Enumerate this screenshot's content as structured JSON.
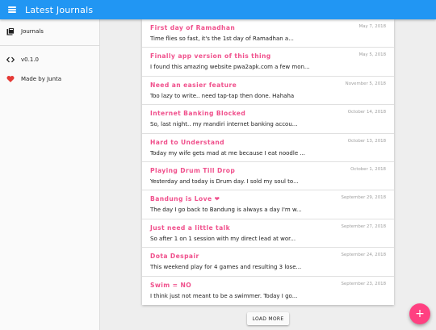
{
  "appbar": {
    "title": "Latest Journals",
    "color": "#2196f3"
  },
  "sidebar": {
    "items": [
      {
        "label": "Journals",
        "icon": "book-stack-icon"
      },
      {
        "label": "v0.1.0",
        "icon": "code-icon"
      },
      {
        "label": "Made by Junta",
        "icon": "heart-icon"
      }
    ]
  },
  "entries": [
    {
      "title": "First day of Ramadhan",
      "snippet": "Time flies so fast, it's the 1st day of Ramadhan a...",
      "date": "May 7, 2018"
    },
    {
      "title": "Finally app version of this thing",
      "snippet": "I found this amazing website pwa2apk.com a few mon...",
      "date": "May 5, 2018"
    },
    {
      "title": "Need an easier feature",
      "snippet": "Too lazy to write.. need tap-tap then done. Hahaha",
      "date": "November 5, 2018"
    },
    {
      "title": "Internet Banking Blocked",
      "snippet": "So, last night.. my mandiri internet banking accou...",
      "date": "October 14, 2018"
    },
    {
      "title": "Hard to Understand",
      "snippet": "Today my wife gets mad at me because I eat noodle ...",
      "date": "October 13, 2018"
    },
    {
      "title": "Playing Drum Till Drop",
      "snippet": "Yesterday and today is Drum day. I sold my soul to...",
      "date": "October 1, 2018"
    },
    {
      "title": "Bandung is Love ❤",
      "snippet": "The day I go back to Bandung is always a day I'm w...",
      "date": "September 29, 2018"
    },
    {
      "title": "Just need a little talk",
      "snippet": "So after 1 on 1 session with my direct lead at wor...",
      "date": "September 27, 2018"
    },
    {
      "title": "Dota Despair",
      "snippet": "This weekend play for 4 games and resulting 3 lose...",
      "date": "September 24, 2018"
    },
    {
      "title": "Swim = NO",
      "snippet": "I think just not meant to be a swimmer. Today I go...",
      "date": "September 23, 2018"
    }
  ],
  "load_more_label": "LOAD MORE",
  "fab": {
    "label": "+",
    "icon": "plus-icon",
    "color": "#ff4081"
  },
  "accent_title_color": "#f0508c"
}
